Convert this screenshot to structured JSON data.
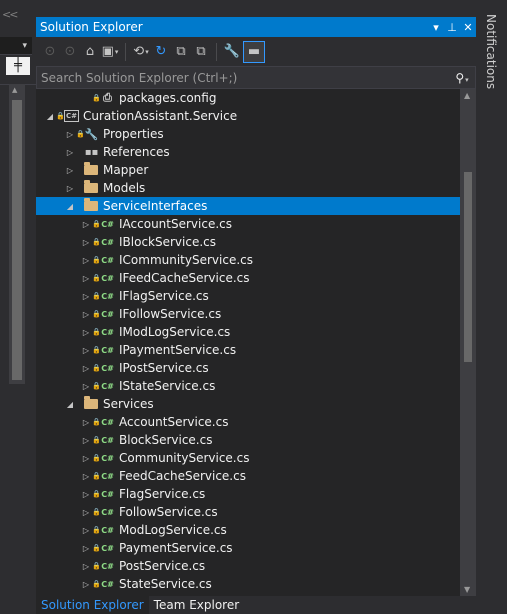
{
  "left": {
    "chevrons": "<<",
    "dropdown_caret": "▾",
    "splitter_glyph": "╪",
    "scroll_up": "▲"
  },
  "window": {
    "title": "Solution Explorer",
    "btn_dropdown": "▾",
    "btn_pin": "⊥",
    "btn_close": "✕"
  },
  "toolbar": {
    "back": "⊙",
    "forward": "⊙",
    "home": "⌂",
    "switch_views": "▣",
    "caret": "▾",
    "history": "⟲",
    "refresh": "↻",
    "collapse_all": "⧉",
    "show_all": "⧉",
    "properties": "🔧",
    "preview": "▬"
  },
  "search": {
    "placeholder": "Search Solution Explorer (Ctrl+;)",
    "icon": "⚲",
    "caret": "▾"
  },
  "tree": [
    {
      "label": "packages.config",
      "indent": 2,
      "expander": "",
      "lock": "🔒",
      "icon": "config",
      "glyph": "⎙",
      "selected": false
    },
    {
      "label": "CurationAssistant.Service",
      "indent": 0,
      "expander": "◢",
      "lock": "🔒",
      "icon": "csproj",
      "glyph": "C#",
      "selected": false
    },
    {
      "label": "Properties",
      "indent": 1,
      "expander": "▷",
      "lock": "🔒",
      "icon": "wrench",
      "glyph": "🔧",
      "selected": false
    },
    {
      "label": "References",
      "indent": 1,
      "expander": "▷",
      "lock": "",
      "icon": "refs",
      "glyph": "▪▪",
      "selected": false
    },
    {
      "label": "Mapper",
      "indent": 1,
      "expander": "▷",
      "lock": "",
      "icon": "folder",
      "glyph": "",
      "selected": false
    },
    {
      "label": "Models",
      "indent": 1,
      "expander": "▷",
      "lock": "",
      "icon": "folder",
      "glyph": "",
      "selected": false
    },
    {
      "label": "ServiceInterfaces",
      "indent": 1,
      "expander": "◢",
      "lock": "",
      "icon": "folder",
      "glyph": "",
      "selected": true
    },
    {
      "label": "IAccountService.cs",
      "indent": 2,
      "expander": "▷",
      "lock": "🔒",
      "icon": "cs",
      "glyph": "C#",
      "selected": false
    },
    {
      "label": "IBlockService.cs",
      "indent": 2,
      "expander": "▷",
      "lock": "🔒",
      "icon": "cs",
      "glyph": "C#",
      "selected": false
    },
    {
      "label": "ICommunityService.cs",
      "indent": 2,
      "expander": "▷",
      "lock": "🔒",
      "icon": "cs",
      "glyph": "C#",
      "selected": false
    },
    {
      "label": "IFeedCacheService.cs",
      "indent": 2,
      "expander": "▷",
      "lock": "🔒",
      "icon": "cs",
      "glyph": "C#",
      "selected": false
    },
    {
      "label": "IFlagService.cs",
      "indent": 2,
      "expander": "▷",
      "lock": "🔒",
      "icon": "cs",
      "glyph": "C#",
      "selected": false
    },
    {
      "label": "IFollowService.cs",
      "indent": 2,
      "expander": "▷",
      "lock": "🔒",
      "icon": "cs",
      "glyph": "C#",
      "selected": false
    },
    {
      "label": "IModLogService.cs",
      "indent": 2,
      "expander": "▷",
      "lock": "🔒",
      "icon": "cs",
      "glyph": "C#",
      "selected": false
    },
    {
      "label": "IPaymentService.cs",
      "indent": 2,
      "expander": "▷",
      "lock": "🔒",
      "icon": "cs",
      "glyph": "C#",
      "selected": false
    },
    {
      "label": "IPostService.cs",
      "indent": 2,
      "expander": "▷",
      "lock": "🔒",
      "icon": "cs",
      "glyph": "C#",
      "selected": false
    },
    {
      "label": "IStateService.cs",
      "indent": 2,
      "expander": "▷",
      "lock": "🔒",
      "icon": "cs",
      "glyph": "C#",
      "selected": false
    },
    {
      "label": "Services",
      "indent": 1,
      "expander": "◢",
      "lock": "",
      "icon": "folder",
      "glyph": "",
      "selected": false
    },
    {
      "label": "AccountService.cs",
      "indent": 2,
      "expander": "▷",
      "lock": "🔒",
      "icon": "cs",
      "glyph": "C#",
      "selected": false
    },
    {
      "label": "BlockService.cs",
      "indent": 2,
      "expander": "▷",
      "lock": "🔒",
      "icon": "cs",
      "glyph": "C#",
      "selected": false
    },
    {
      "label": "CommunityService.cs",
      "indent": 2,
      "expander": "▷",
      "lock": "🔒",
      "icon": "cs",
      "glyph": "C#",
      "selected": false
    },
    {
      "label": "FeedCacheService.cs",
      "indent": 2,
      "expander": "▷",
      "lock": "🔒",
      "icon": "cs",
      "glyph": "C#",
      "selected": false
    },
    {
      "label": "FlagService.cs",
      "indent": 2,
      "expander": "▷",
      "lock": "🔒",
      "icon": "cs",
      "glyph": "C#",
      "selected": false
    },
    {
      "label": "FollowService.cs",
      "indent": 2,
      "expander": "▷",
      "lock": "🔒",
      "icon": "cs",
      "glyph": "C#",
      "selected": false
    },
    {
      "label": "ModLogService.cs",
      "indent": 2,
      "expander": "▷",
      "lock": "🔒",
      "icon": "cs",
      "glyph": "C#",
      "selected": false
    },
    {
      "label": "PaymentService.cs",
      "indent": 2,
      "expander": "▷",
      "lock": "🔒",
      "icon": "cs",
      "glyph": "C#",
      "selected": false
    },
    {
      "label": "PostService.cs",
      "indent": 2,
      "expander": "▷",
      "lock": "🔒",
      "icon": "cs",
      "glyph": "C#",
      "selected": false
    },
    {
      "label": "StateService.cs",
      "indent": 2,
      "expander": "▷",
      "lock": "🔒",
      "icon": "cs",
      "glyph": "C#",
      "selected": false
    }
  ],
  "scrollbar": {
    "up": "▲",
    "down": "▼"
  },
  "tabs": [
    {
      "label": "Solution Explorer",
      "active": true
    },
    {
      "label": "Team Explorer",
      "active": false
    }
  ],
  "right": {
    "notifications": "Notifications"
  },
  "colors": {
    "accent": "#007acc",
    "background": "#252526",
    "chrome": "#2d2d30",
    "cs_icon": "#8fdc87",
    "folder": "#dcb67a"
  }
}
